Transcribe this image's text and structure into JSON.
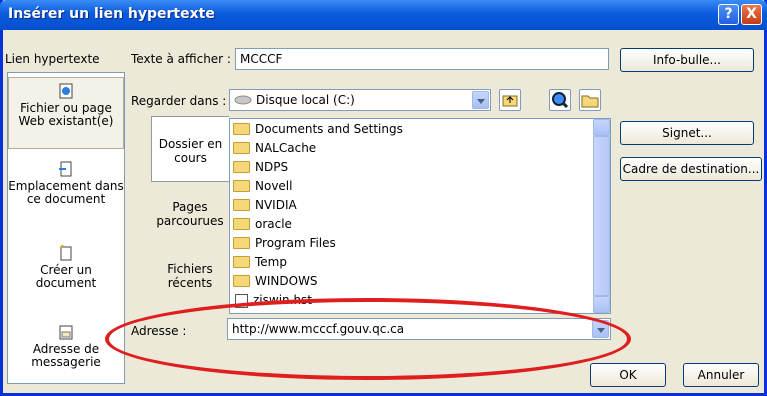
{
  "window": {
    "title": "Insérer un lien hypertexte",
    "help_label": "?",
    "close_label": "X"
  },
  "link_to_label": "Lien hypertexte",
  "text_to_display": {
    "label": "Texte à afficher :",
    "value": "MCCCF"
  },
  "screentip_button": "Info-bulle...",
  "look_in": {
    "label": "Regarder dans :",
    "value": "Disque local (C:)"
  },
  "left_nav": [
    {
      "label": "Fichier ou page Web existant(e)",
      "selected": true,
      "icon": "web-page-icon"
    },
    {
      "label": "Emplacement dans ce document",
      "icon": "document-place-icon"
    },
    {
      "label": "Créer un document",
      "icon": "new-document-icon"
    },
    {
      "label": "Adresse de messagerie",
      "icon": "email-icon"
    }
  ],
  "inner_tabs": [
    {
      "label": "Dossier en cours",
      "selected": true
    },
    {
      "label": "Pages parcourues"
    },
    {
      "label": "Fichiers récents"
    }
  ],
  "files": [
    {
      "name": "Documents and Settings",
      "type": "folder"
    },
    {
      "name": "NALCache",
      "type": "folder"
    },
    {
      "name": "NDPS",
      "type": "folder"
    },
    {
      "name": "Novell",
      "type": "folder"
    },
    {
      "name": "NVIDIA",
      "type": "folder"
    },
    {
      "name": "oracle",
      "type": "folder"
    },
    {
      "name": "Program Files",
      "type": "folder"
    },
    {
      "name": "Temp",
      "type": "folder"
    },
    {
      "name": "WINDOWS",
      "type": "folder"
    },
    {
      "name": "ziswin.hst",
      "type": "file"
    }
  ],
  "side_buttons": {
    "bookmark": "Signet...",
    "target_frame": "Cadre de destination..."
  },
  "address": {
    "label": "Adresse :",
    "value": "http://www.mcccf.gouv.qc.ca"
  },
  "ok_button": "OK",
  "cancel_button": "Annuler",
  "colors": {
    "title_bar": "#0a5bdd",
    "dialog_bg": "#ece9d8",
    "highlight_ellipse": "#e01e1e"
  }
}
